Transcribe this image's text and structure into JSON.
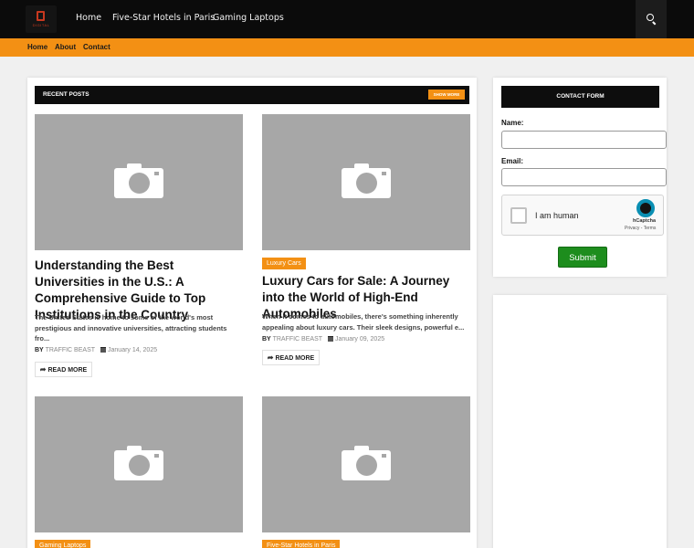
{
  "header": {
    "logo_text": "DIGITAL",
    "nav": [
      "Home",
      "Five-Star Hotels in Paris",
      "Gaming Laptops"
    ],
    "search_icon": "search-icon"
  },
  "subnav": [
    "Home",
    "About",
    "Contact"
  ],
  "recent": {
    "title": "RECENT POSTS",
    "show_more": "SHOW MORE"
  },
  "posts": [
    {
      "tag": "",
      "title": "Understanding the Best Universities in the U.S.: A Comprehensive Guide to Top Institutions in the Country",
      "excerpt": "The United States is home to some of the world's most prestigious and innovative universities, attracting students fro...",
      "by": "BY",
      "author": "TRAFFIC BEAST",
      "date": "January 14, 2025",
      "read_more": "READ MORE"
    },
    {
      "tag": "Luxury Cars",
      "title": "Luxury Cars for Sale: A Journey into the World of High-End Automobiles",
      "excerpt": "When it comes to automobiles, there's something inherently appealing about luxury cars. Their sleek designs, powerful e...",
      "by": "BY",
      "author": "TRAFFIC BEAST",
      "date": "January 09, 2025",
      "read_more": "READ MORE"
    },
    {
      "tag": "Gaming Laptops"
    },
    {
      "tag": "Five-Star Hotels in Paris"
    }
  ],
  "contact": {
    "title": "CONTACT FORM",
    "name_label": "Name:",
    "email_label": "Email:",
    "captcha_label": "I am human",
    "captcha_brand": "hCaptcha",
    "captcha_terms": "Privacy - Terms",
    "submit": "Submit"
  },
  "colors": {
    "accent": "#f39014",
    "dark": "#0b0b0b",
    "submit": "#1d8d1d"
  }
}
